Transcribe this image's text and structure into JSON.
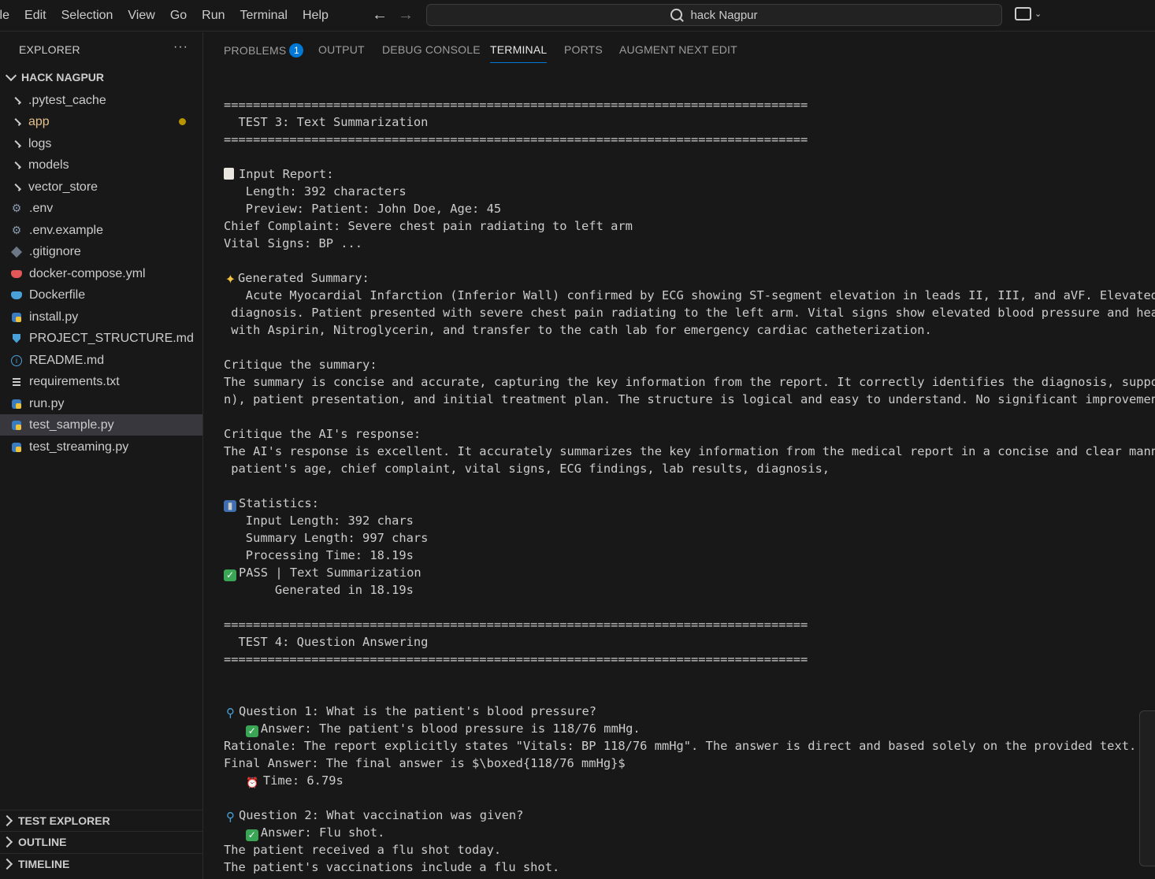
{
  "menu": [
    "ile",
    "Edit",
    "Selection",
    "View",
    "Go",
    "Run",
    "Terminal",
    "Help"
  ],
  "search": {
    "text": "hack Nagpur"
  },
  "sidebar": {
    "title": "EXPLORER",
    "more": "···",
    "folder": "HACK NAGPUR",
    "items": [
      {
        "label": ".pytest_cache",
        "kind": "folder"
      },
      {
        "label": "app",
        "kind": "folder",
        "modified": true
      },
      {
        "label": "logs",
        "kind": "folder"
      },
      {
        "label": "models",
        "kind": "folder"
      },
      {
        "label": "vector_store",
        "kind": "folder"
      },
      {
        "label": ".env",
        "icon": "gear-icon"
      },
      {
        "label": ".env.example",
        "icon": "gear-icon"
      },
      {
        "label": ".gitignore",
        "icon": "git-icon"
      },
      {
        "label": "docker-compose.yml",
        "icon": "docker-icon"
      },
      {
        "label": "Dockerfile",
        "icon": "docker-icon"
      },
      {
        "label": "install.py",
        "icon": "python-icon"
      },
      {
        "label": "PROJECT_STRUCTURE.md",
        "icon": "markdown-icon"
      },
      {
        "label": "README.md",
        "icon": "info-icon"
      },
      {
        "label": "requirements.txt",
        "icon": "lines-icon"
      },
      {
        "label": "run.py",
        "icon": "python-icon"
      },
      {
        "label": "test_sample.py",
        "icon": "python-icon",
        "selected": true
      },
      {
        "label": "test_streaming.py",
        "icon": "python-icon"
      }
    ],
    "sections": [
      "TEST EXPLORER",
      "OUTLINE",
      "TIMELINE"
    ]
  },
  "panel": {
    "tabs": [
      {
        "label": "PROBLEMS",
        "badge": "1"
      },
      {
        "label": "OUTPUT"
      },
      {
        "label": "DEBUG CONSOLE"
      },
      {
        "label": "TERMINAL",
        "active": true
      },
      {
        "label": "PORTS"
      },
      {
        "label": "AUGMENT NEXT EDIT"
      }
    ]
  },
  "terminal": {
    "lines": [
      "================================================================================",
      "  TEST 3: Text Summarization",
      "================================================================================",
      "",
      "Input Report:",
      "   Length: 392 characters",
      "   Preview: Patient: John Doe, Age: 45",
      "Chief Complaint: Severe chest pain radiating to left arm",
      "Vital Signs: BP ...",
      "",
      "Generated Summary:",
      "   Acute Myocardial Infarction (Inferior Wall) confirmed by ECG showing ST-segment elevation in leads II, III, and aVF. Elevated Tro",
      " diagnosis. Patient presented with severe chest pain radiating to the left arm. Vital signs show elevated blood pressure and heart r",
      " with Aspirin, Nitroglycerin, and transfer to the cath lab for emergency cardiac catheterization.",
      "",
      "Critique the summary:",
      "The summary is concise and accurate, capturing the key information from the report. It correctly identifies the diagnosis, supportin",
      "n), patient presentation, and initial treatment plan. The structure is logical and easy to understand. No significant improvements a",
      "",
      "Critique the AI's response:",
      "The AI's response is excellent. It accurately summarizes the key information from the medical report in a concise and clear manner.",
      " patient's age, chief complaint, vital signs, ECG findings, lab results, diagnosis,",
      "",
      "Statistics:",
      "   Input Length: 392 chars",
      "   Summary Length: 997 chars",
      "   Processing Time: 18.19s",
      "PASS | Text Summarization",
      "       Generated in 18.19s",
      "",
      "================================================================================",
      "  TEST 4: Question Answering",
      "================================================================================",
      "",
      "",
      "Question 1: What is the patient's blood pressure?",
      "Answer: The patient's blood pressure is 118/76 mmHg.",
      "Rationale: The report explicitly states \"Vitals: BP 118/76 mmHg\". The answer is direct and based solely on the provided text.",
      "Final Answer: The final answer is $\\boxed{118/76 mmHg}$",
      "Time: 6.79s",
      "",
      "Question 2: What vaccination was given?",
      "Answer: Flu shot.",
      "The patient received a flu shot today.",
      "The patient's vaccinations include a flu shot."
    ],
    "emoji": {
      "4": "page-icon",
      "10": "sparkles-icon",
      "23": "bar-chart-icon",
      "27": "check-icon",
      "35": "magnifier-icon",
      "36": "check-icon",
      "39": "alarm-clock-icon",
      "41": "magnifier-icon",
      "42": "check-icon"
    }
  },
  "colors": {
    "background": "#181818",
    "selection": "#37373d",
    "accent": "#0078d4",
    "modified": "#e2c08d"
  }
}
